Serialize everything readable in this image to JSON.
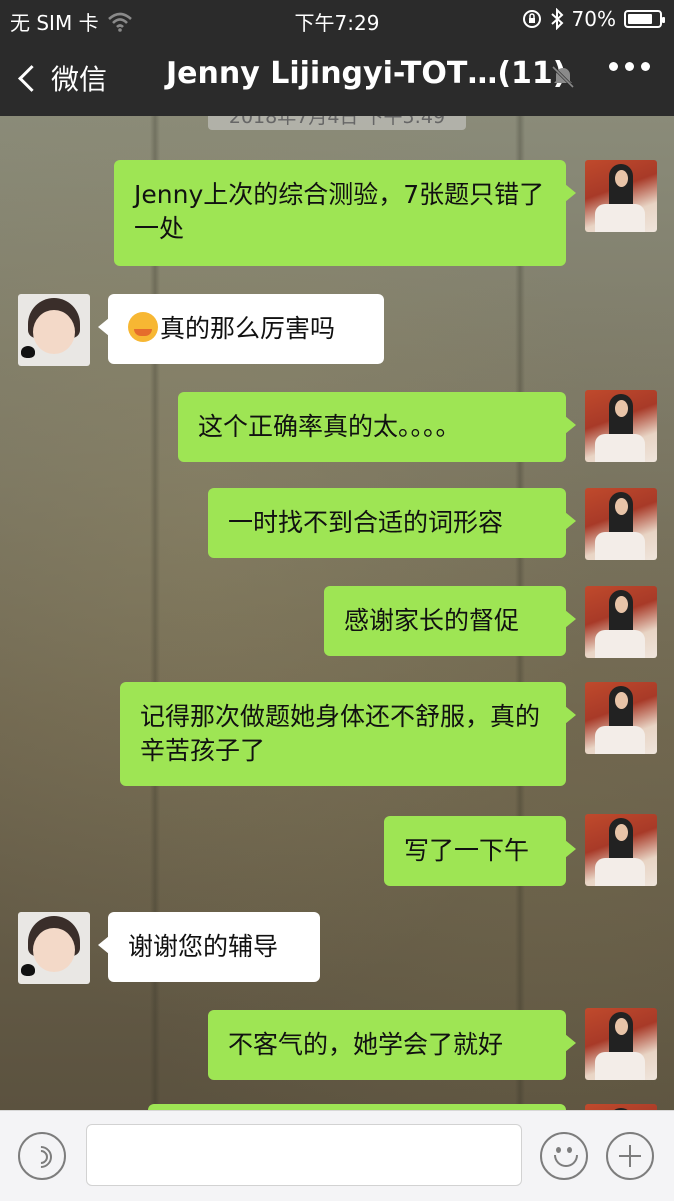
{
  "status_bar": {
    "carrier": "无 SIM 卡",
    "time": "下午7:29",
    "battery": "70%",
    "battery_level": 0.7,
    "icons": [
      "wifi-icon",
      "lock-rotation-icon",
      "bluetooth-icon",
      "battery-icon"
    ]
  },
  "nav": {
    "back_label": "微信",
    "title": "Jenny Lijingyi-TOT…(11)",
    "icons": [
      "back-chevron-icon",
      "mute-icon",
      "more-icon"
    ]
  },
  "chat": {
    "timestamp": "2018年7月4日 下午5:49",
    "messages": [
      {
        "from": "me",
        "text": "Jenny上次的综合测验，7张题只错了一处"
      },
      {
        "from": "them",
        "text": "真的那么厉害吗",
        "emoji": "hugging-face-emoji"
      },
      {
        "from": "me",
        "text": "这个正确率真的太。。。。"
      },
      {
        "from": "me",
        "text": "一时找不到合适的词形容"
      },
      {
        "from": "me",
        "text": "感谢家长的督促"
      },
      {
        "from": "me",
        "text": "记得那次做题她身体还不舒服，真的辛苦孩子了"
      },
      {
        "from": "me",
        "text": "写了一下午"
      },
      {
        "from": "them",
        "text": "谢谢您的辅导"
      },
      {
        "from": "me",
        "text": "不客气的，她学会了就好"
      }
    ]
  },
  "input_bar": {
    "icons": [
      "voice-icon",
      "emoji-icon",
      "plus-icon"
    ]
  },
  "colors": {
    "outgoing_bubble": "#9ee554",
    "incoming_bubble": "#ffffff",
    "nav_background": "#2b2b2b"
  }
}
